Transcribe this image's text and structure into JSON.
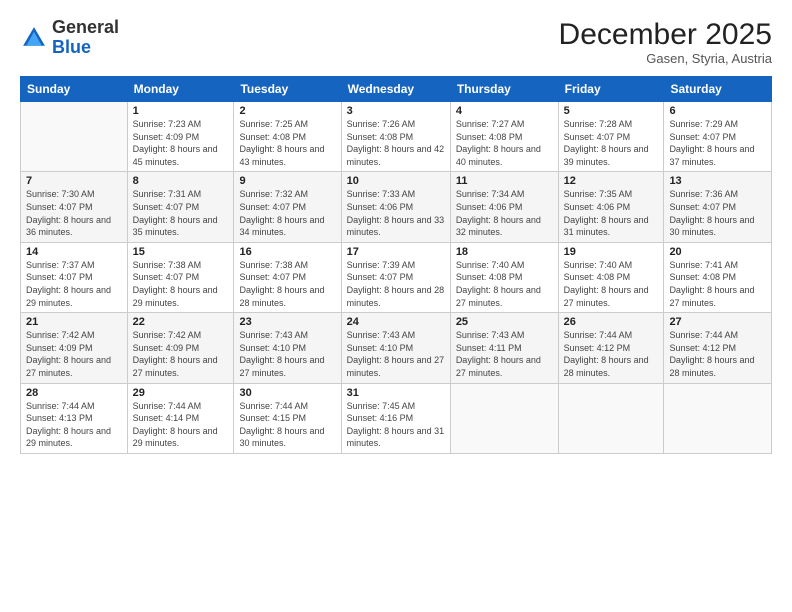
{
  "header": {
    "logo_general": "General",
    "logo_blue": "Blue",
    "month_title": "December 2025",
    "subtitle": "Gasen, Styria, Austria"
  },
  "weekdays": [
    "Sunday",
    "Monday",
    "Tuesday",
    "Wednesday",
    "Thursday",
    "Friday",
    "Saturday"
  ],
  "weeks": [
    [
      {
        "num": "",
        "sunrise": "",
        "sunset": "",
        "daylight": ""
      },
      {
        "num": "1",
        "sunrise": "Sunrise: 7:23 AM",
        "sunset": "Sunset: 4:09 PM",
        "daylight": "Daylight: 8 hours and 45 minutes."
      },
      {
        "num": "2",
        "sunrise": "Sunrise: 7:25 AM",
        "sunset": "Sunset: 4:08 PM",
        "daylight": "Daylight: 8 hours and 43 minutes."
      },
      {
        "num": "3",
        "sunrise": "Sunrise: 7:26 AM",
        "sunset": "Sunset: 4:08 PM",
        "daylight": "Daylight: 8 hours and 42 minutes."
      },
      {
        "num": "4",
        "sunrise": "Sunrise: 7:27 AM",
        "sunset": "Sunset: 4:08 PM",
        "daylight": "Daylight: 8 hours and 40 minutes."
      },
      {
        "num": "5",
        "sunrise": "Sunrise: 7:28 AM",
        "sunset": "Sunset: 4:07 PM",
        "daylight": "Daylight: 8 hours and 39 minutes."
      },
      {
        "num": "6",
        "sunrise": "Sunrise: 7:29 AM",
        "sunset": "Sunset: 4:07 PM",
        "daylight": "Daylight: 8 hours and 37 minutes."
      }
    ],
    [
      {
        "num": "7",
        "sunrise": "Sunrise: 7:30 AM",
        "sunset": "Sunset: 4:07 PM",
        "daylight": "Daylight: 8 hours and 36 minutes."
      },
      {
        "num": "8",
        "sunrise": "Sunrise: 7:31 AM",
        "sunset": "Sunset: 4:07 PM",
        "daylight": "Daylight: 8 hours and 35 minutes."
      },
      {
        "num": "9",
        "sunrise": "Sunrise: 7:32 AM",
        "sunset": "Sunset: 4:07 PM",
        "daylight": "Daylight: 8 hours and 34 minutes."
      },
      {
        "num": "10",
        "sunrise": "Sunrise: 7:33 AM",
        "sunset": "Sunset: 4:06 PM",
        "daylight": "Daylight: 8 hours and 33 minutes."
      },
      {
        "num": "11",
        "sunrise": "Sunrise: 7:34 AM",
        "sunset": "Sunset: 4:06 PM",
        "daylight": "Daylight: 8 hours and 32 minutes."
      },
      {
        "num": "12",
        "sunrise": "Sunrise: 7:35 AM",
        "sunset": "Sunset: 4:06 PM",
        "daylight": "Daylight: 8 hours and 31 minutes."
      },
      {
        "num": "13",
        "sunrise": "Sunrise: 7:36 AM",
        "sunset": "Sunset: 4:07 PM",
        "daylight": "Daylight: 8 hours and 30 minutes."
      }
    ],
    [
      {
        "num": "14",
        "sunrise": "Sunrise: 7:37 AM",
        "sunset": "Sunset: 4:07 PM",
        "daylight": "Daylight: 8 hours and 29 minutes."
      },
      {
        "num": "15",
        "sunrise": "Sunrise: 7:38 AM",
        "sunset": "Sunset: 4:07 PM",
        "daylight": "Daylight: 8 hours and 29 minutes."
      },
      {
        "num": "16",
        "sunrise": "Sunrise: 7:38 AM",
        "sunset": "Sunset: 4:07 PM",
        "daylight": "Daylight: 8 hours and 28 minutes."
      },
      {
        "num": "17",
        "sunrise": "Sunrise: 7:39 AM",
        "sunset": "Sunset: 4:07 PM",
        "daylight": "Daylight: 8 hours and 28 minutes."
      },
      {
        "num": "18",
        "sunrise": "Sunrise: 7:40 AM",
        "sunset": "Sunset: 4:08 PM",
        "daylight": "Daylight: 8 hours and 27 minutes."
      },
      {
        "num": "19",
        "sunrise": "Sunrise: 7:40 AM",
        "sunset": "Sunset: 4:08 PM",
        "daylight": "Daylight: 8 hours and 27 minutes."
      },
      {
        "num": "20",
        "sunrise": "Sunrise: 7:41 AM",
        "sunset": "Sunset: 4:08 PM",
        "daylight": "Daylight: 8 hours and 27 minutes."
      }
    ],
    [
      {
        "num": "21",
        "sunrise": "Sunrise: 7:42 AM",
        "sunset": "Sunset: 4:09 PM",
        "daylight": "Daylight: 8 hours and 27 minutes."
      },
      {
        "num": "22",
        "sunrise": "Sunrise: 7:42 AM",
        "sunset": "Sunset: 4:09 PM",
        "daylight": "Daylight: 8 hours and 27 minutes."
      },
      {
        "num": "23",
        "sunrise": "Sunrise: 7:43 AM",
        "sunset": "Sunset: 4:10 PM",
        "daylight": "Daylight: 8 hours and 27 minutes."
      },
      {
        "num": "24",
        "sunrise": "Sunrise: 7:43 AM",
        "sunset": "Sunset: 4:10 PM",
        "daylight": "Daylight: 8 hours and 27 minutes."
      },
      {
        "num": "25",
        "sunrise": "Sunrise: 7:43 AM",
        "sunset": "Sunset: 4:11 PM",
        "daylight": "Daylight: 8 hours and 27 minutes."
      },
      {
        "num": "26",
        "sunrise": "Sunrise: 7:44 AM",
        "sunset": "Sunset: 4:12 PM",
        "daylight": "Daylight: 8 hours and 28 minutes."
      },
      {
        "num": "27",
        "sunrise": "Sunrise: 7:44 AM",
        "sunset": "Sunset: 4:12 PM",
        "daylight": "Daylight: 8 hours and 28 minutes."
      }
    ],
    [
      {
        "num": "28",
        "sunrise": "Sunrise: 7:44 AM",
        "sunset": "Sunset: 4:13 PM",
        "daylight": "Daylight: 8 hours and 29 minutes."
      },
      {
        "num": "29",
        "sunrise": "Sunrise: 7:44 AM",
        "sunset": "Sunset: 4:14 PM",
        "daylight": "Daylight: 8 hours and 29 minutes."
      },
      {
        "num": "30",
        "sunrise": "Sunrise: 7:44 AM",
        "sunset": "Sunset: 4:15 PM",
        "daylight": "Daylight: 8 hours and 30 minutes."
      },
      {
        "num": "31",
        "sunrise": "Sunrise: 7:45 AM",
        "sunset": "Sunset: 4:16 PM",
        "daylight": "Daylight: 8 hours and 31 minutes."
      },
      {
        "num": "",
        "sunrise": "",
        "sunset": "",
        "daylight": ""
      },
      {
        "num": "",
        "sunrise": "",
        "sunset": "",
        "daylight": ""
      },
      {
        "num": "",
        "sunrise": "",
        "sunset": "",
        "daylight": ""
      }
    ]
  ]
}
